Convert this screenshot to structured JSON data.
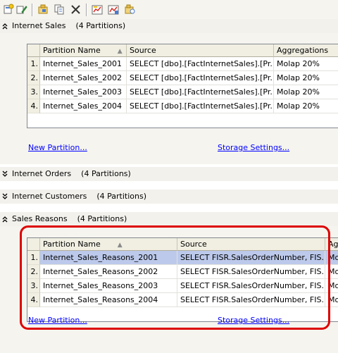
{
  "toolbar": {
    "buttons": [
      {
        "icon": "new-partition-icon"
      },
      {
        "icon": "edit-partition-icon"
      },
      {
        "icon": "process-icon"
      },
      {
        "icon": "copy-icon"
      },
      {
        "icon": "delete-icon"
      },
      {
        "icon": "design-aggregations-icon"
      },
      {
        "icon": "usage-based-optimization-icon"
      },
      {
        "icon": "merge-partitions-icon"
      }
    ]
  },
  "groups": [
    {
      "title": "Internet Sales",
      "count": "(4 Partitions)",
      "expanded": true,
      "columns": [
        "Partition Name",
        "Source",
        "Aggregations"
      ],
      "sort_glyph": "▲",
      "rows": [
        {
          "num": "1.",
          "name": "Internet_Sales_2001",
          "source": "SELECT [dbo].[FactInternetSales].[Pr...",
          "agg": "Molap 20%"
        },
        {
          "num": "2.",
          "name": "Internet_Sales_2002",
          "source": "SELECT [dbo].[FactInternetSales].[Pr...",
          "agg": "Molap 20%"
        },
        {
          "num": "3.",
          "name": "Internet_Sales_2003",
          "source": "SELECT [dbo].[FactInternetSales].[Pr...",
          "agg": "Molap 20%"
        },
        {
          "num": "4.",
          "name": "Internet_Sales_2004",
          "source": "SELECT [dbo].[FactInternetSales].[Pr...",
          "agg": "Molap 20%"
        }
      ],
      "new_partition_link": "New Partition...",
      "storage_settings_link": "Storage Settings..."
    },
    {
      "title": "Internet Orders",
      "count": "(4 Partitions)",
      "expanded": false
    },
    {
      "title": "Internet Customers",
      "count": "(4 Partitions)",
      "expanded": false
    },
    {
      "title": "Sales Reasons",
      "count": "(4 Partitions)",
      "expanded": true,
      "columns": [
        "Partition Name",
        "Source",
        "Agg"
      ],
      "sort_glyph": "▲",
      "rows": [
        {
          "num": "1.",
          "name": "Internet_Sales_Reasons_2001",
          "source": "SELECT FISR.SalesOrderNumber, FIS...",
          "agg": "Mo"
        },
        {
          "num": "2.",
          "name": "Internet_Sales_Reasons_2002",
          "source": "SELECT FISR.SalesOrderNumber, FIS...",
          "agg": "Mo"
        },
        {
          "num": "3.",
          "name": "Internet_Sales_Reasons_2003",
          "source": "SELECT FISR.SalesOrderNumber, FIS...",
          "agg": "Mo"
        },
        {
          "num": "4.",
          "name": "Internet_Sales_Reasons_2004",
          "source": "SELECT FISR.SalesOrderNumber, FIS...",
          "agg": "Mo"
        }
      ],
      "new_partition_link": "New Partition...",
      "storage_settings_link": "Storage Settings..."
    }
  ],
  "colors": {
    "selection": "#bcc9eb",
    "highlight_box": "#dd0000",
    "link": "#0000ff"
  }
}
